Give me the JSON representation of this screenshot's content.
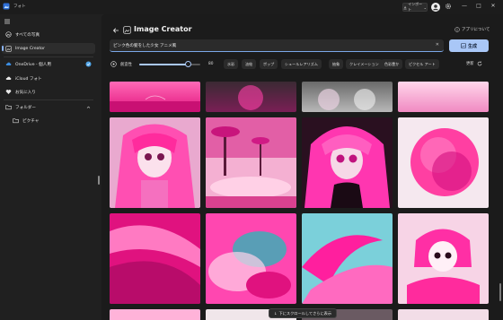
{
  "titlebar": {
    "app_title": "フォト",
    "import_label": "インポート",
    "import_caret": "⌄",
    "window_controls": {
      "minimize": "—",
      "maximize": "□",
      "close": "✕"
    }
  },
  "sidebar": {
    "items": [
      {
        "label": "すべての写真"
      },
      {
        "label": "Image Creator"
      },
      {
        "label": "OneDrive - 個人用"
      },
      {
        "label": "iCloud フォト"
      },
      {
        "label": "お気に入り"
      },
      {
        "label": "フォルダー"
      },
      {
        "label": "ピクチャ"
      }
    ]
  },
  "header": {
    "title": "Image Creator",
    "about_label": "アプリについて"
  },
  "prompt": {
    "value": "ピンク色の髪をした少女 アニメ風",
    "clear_glyph": "✕",
    "generate_label": "生成"
  },
  "options": {
    "creativity_label": "創造性",
    "creativity_value": "80",
    "creativity_fraction": 0.8,
    "styles": [
      "水彩",
      "油絵",
      "ポップ",
      "シュールレアリズム",
      "抽象",
      "クレイメーション",
      "色彩豊か",
      "ピクセル アート"
    ],
    "refresh_label": "更新"
  },
  "scroll_hint": {
    "label": "下にスクロールしてさらに表示",
    "arrow": "↓"
  },
  "colors": {
    "accent": "#a9c7f7",
    "pink": "#ff2b9d",
    "magenta": "#e0129a"
  }
}
